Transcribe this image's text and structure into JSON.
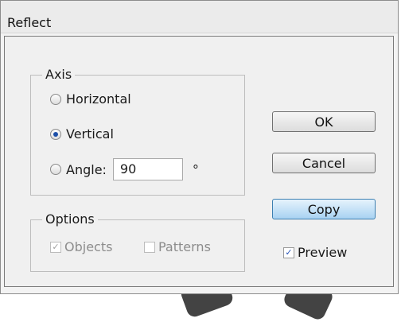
{
  "dialog": {
    "title": "Reflect"
  },
  "axis": {
    "legend": "Axis",
    "options": [
      {
        "label": "Horizontal",
        "selected": false
      },
      {
        "label": "Vertical",
        "selected": true
      },
      {
        "label": "Angle:",
        "selected": false
      }
    ],
    "angle_value": "90",
    "degree_symbol": "°"
  },
  "options_group": {
    "legend": "Options",
    "objects_label": "Objects",
    "objects_checked": true,
    "patterns_label": "Patterns",
    "patterns_checked": false
  },
  "buttons": {
    "ok": "OK",
    "cancel": "Cancel",
    "copy": "Copy"
  },
  "preview": {
    "label": "Preview",
    "checked": true
  },
  "colors": {
    "default_button": "#a8d2f2",
    "radio_selected": "#1d4fa8"
  }
}
